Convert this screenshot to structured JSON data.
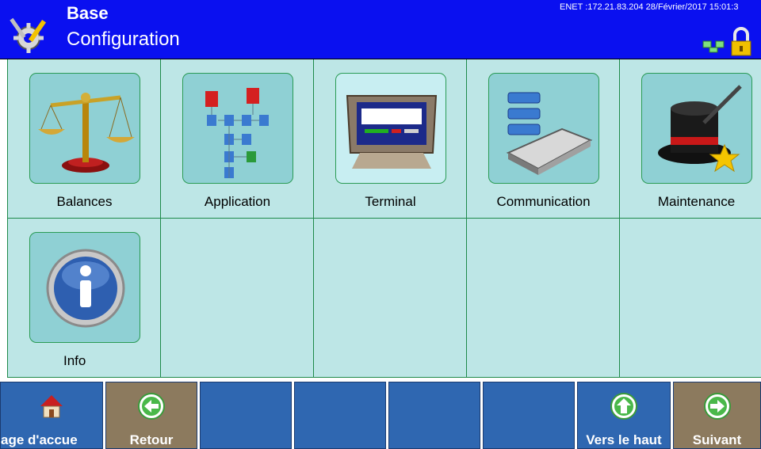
{
  "header": {
    "title": "Base",
    "subtitle": "Configuration",
    "status": "ENET :172.21.83.204  28/Février/2017 15:01:3",
    "logo_icon": "gear-tools-icon",
    "network_icon": "network-icon",
    "lock_icon": "padlock-icon",
    "colors": {
      "background": "#0a10f0",
      "text": "#ffffff"
    }
  },
  "grid": {
    "background": "#bde6e6",
    "items": [
      {
        "label": "Balances",
        "icon": "scale-icon"
      },
      {
        "label": "Application",
        "icon": "application-tree-icon"
      },
      {
        "label": "Terminal",
        "icon": "terminal-icon"
      },
      {
        "label": "Communication",
        "icon": "communication-icon"
      },
      {
        "label": "Maintenance",
        "icon": "magic-hat-icon"
      },
      {
        "label": "Info",
        "icon": "info-icon"
      }
    ]
  },
  "softkeys": [
    {
      "label": "Page d'accueil",
      "display": "age d'accue",
      "icon": "home-icon"
    },
    {
      "label": "Retour",
      "icon": "arrow-left-icon"
    },
    {
      "label": ""
    },
    {
      "label": ""
    },
    {
      "label": ""
    },
    {
      "label": ""
    },
    {
      "label": "Vers le haut",
      "icon": "arrow-up-icon"
    },
    {
      "label": "Suivant",
      "icon": "arrow-right-icon"
    }
  ]
}
